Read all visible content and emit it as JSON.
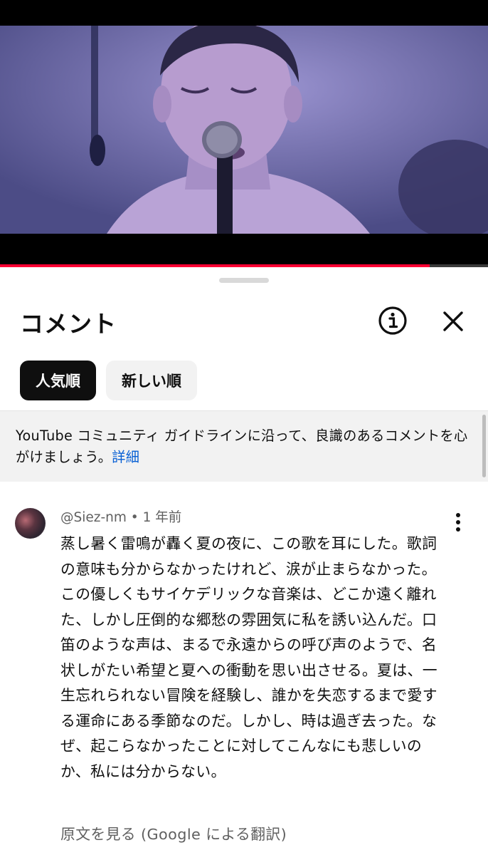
{
  "video": {
    "progress_fraction": 0.88
  },
  "sheet": {
    "title": "コメント",
    "info_icon": "info-circle-icon",
    "close_icon": "close-icon"
  },
  "sort_chips": [
    {
      "label": "人気順",
      "selected": true
    },
    {
      "label": "新しい順",
      "selected": false
    }
  ],
  "guideline": {
    "text": "YouTube コミュニティ ガイドラインに沿って、良識のあるコメントを心がけましょう。",
    "link": "詳細"
  },
  "comment": {
    "author": "@Siez-nm",
    "separator": "•",
    "time": "1 年前",
    "menu_icon": "more-vertical-icon",
    "text": "蒸し暑く雷鳴が轟く夏の夜に、この歌を耳にした。歌詞の意味も分からなかったけれど、涙が止まらなかった。この優しくもサイケデリックな音楽は、どこか遠く離れた、しかし圧倒的な郷愁の雰囲気に私を誘い込んだ。口笛のような声は、まるで永遠からの呼び声のようで、名状しがたい希望と夏への衝動を思い出させる。夏は、一生忘れられない冒険を経験し、誰かを失恋するまで愛する運命にある季節なのだ。しかし、時は過ぎ去った。なぜ、起こらなかったことに対してこんなにも悲しいのか、私には分からない。",
    "translation_link": "原文を見る (Google による翻訳)"
  }
}
